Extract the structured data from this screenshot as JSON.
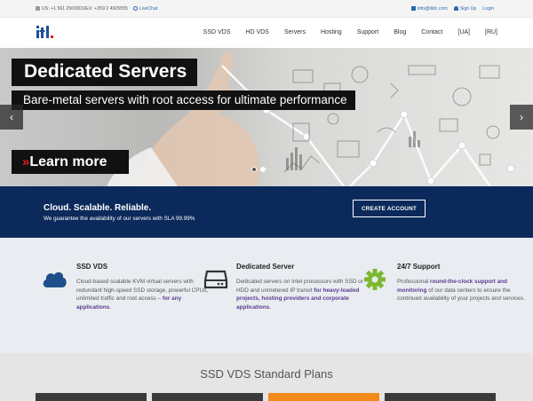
{
  "topbar": {
    "phones": "US: +1 561 2500001/EU: +359 2 4925555",
    "livechat": "LiveChat",
    "email": "info@itldc.com",
    "signup": "Sign Up",
    "login": "Login"
  },
  "nav": {
    "items": [
      "SSD VDS",
      "HD VDS",
      "Servers",
      "Hosting",
      "Support",
      "Blog",
      "Contact",
      "[UA]",
      "[RU]"
    ]
  },
  "hero": {
    "title": "Dedicated Servers",
    "subtitle": "Bare-metal servers with root access for ultimate performance",
    "cta": "Learn more",
    "slides": 2,
    "active_slide": 2
  },
  "banner": {
    "headline": "Cloud. Scalable. Reliable.",
    "subline": "We guarantee the availability of our servers with SLA 99.99%",
    "button": "CREATE ACCOUNT"
  },
  "features": [
    {
      "title": "SSD VDS",
      "icon": "cloud-icon",
      "text": "Cloud-based scalable KVM virtual servers with redundant high-speed SSD storage, powerful CPUs, unlimited traffic and root access –",
      "highlight": "for any applications",
      "text_after": "."
    },
    {
      "title": "Dedicated Server",
      "icon": "server-icon",
      "text": "Dedicated servers on Intel processors with SSD or HDD and unmetered IP transit",
      "highlight": "for heavy-loaded projects, hosting providers and corporate applications",
      "text_after": "."
    },
    {
      "title": "24/7 Support",
      "icon": "gear-icon",
      "text_before": "Professional",
      "highlight": "round-the-clock support and monitoring",
      "text": "of our data centers to ensure the continued availability of your projects and services."
    }
  ],
  "plans": {
    "title": "SSD VDS Standard Plans"
  },
  "colors": {
    "banner": "#0b2a5b",
    "accent_purple": "#5b3a8f",
    "feature_green": "#7cb82f",
    "plan_highlight": "#f28a1c"
  }
}
